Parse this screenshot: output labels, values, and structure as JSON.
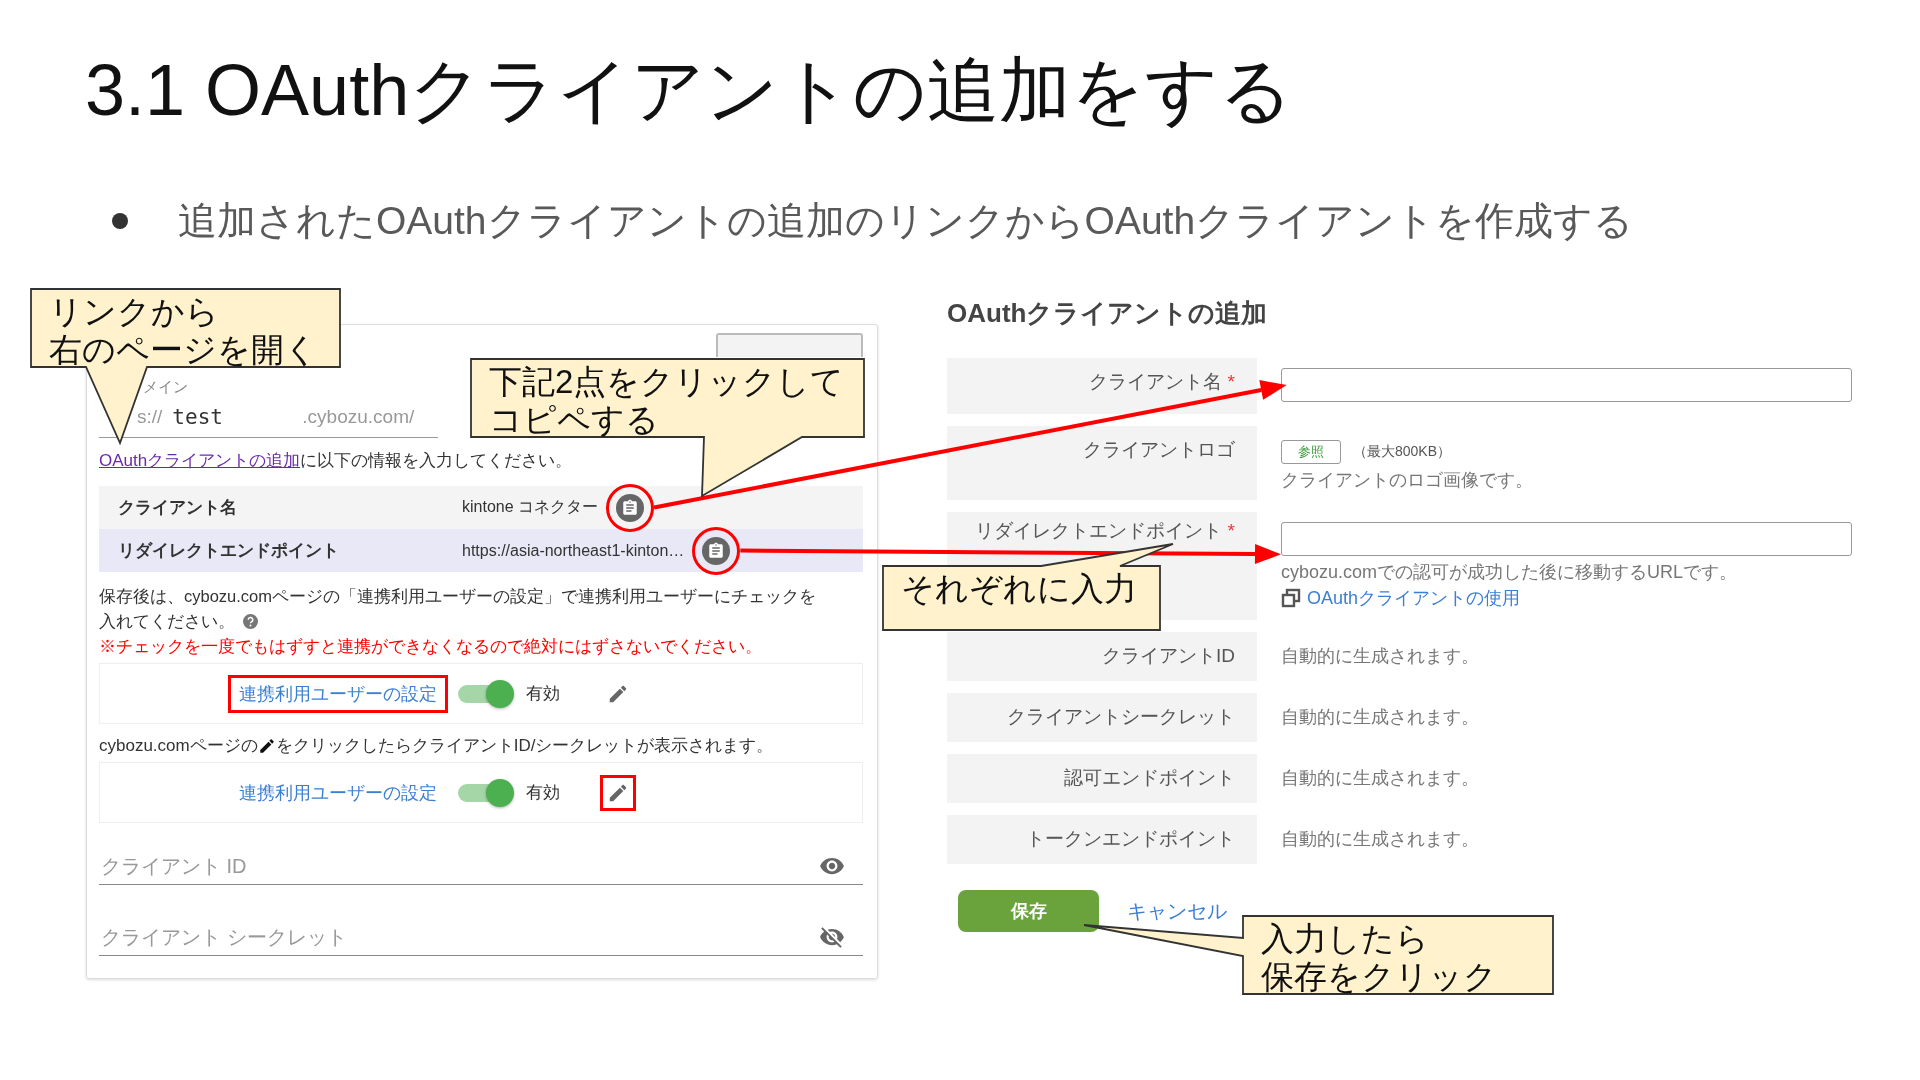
{
  "title": "3.1 OAuthクライアントの追加をする",
  "bullets": [
    "追加されたOAuthクライアントの追加のリンクからOAuthクライアントを作成する"
  ],
  "left_screen": {
    "domain_label": "メイン",
    "domain_prefix": "s://",
    "domain_value": "test",
    "domain_suffix": ".cybozu.com/",
    "instruction": {
      "link": "OAuthクライアントの追加",
      "text": "に以下の情報を入力してください。"
    },
    "info_rows": [
      {
        "label": "クライアント名",
        "value": "kintone コネクター",
        "highlighted": true
      },
      {
        "label": "リダイレクトエンドポイント",
        "value": "https://asia-northeast1-kinton…",
        "highlighted": true
      }
    ],
    "note_lines": [
      "保存後は、cybozu.comページの「連携利用ユーザーの設定」で連携利用ユーザーにチェックを",
      "入れてください。"
    ],
    "warning": "※チェックを一度でもはずすと連携ができなくなるので絶対にはずさないでください。",
    "settings_boxes": [
      {
        "link": "連携利用ユーザーの設定",
        "on": true,
        "state_label": "有効",
        "link_highlighted": true,
        "edit_highlighted": false
      },
      {
        "link": "連携利用ユーザーの設定",
        "on": true,
        "state_label": "有効",
        "link_highlighted": false,
        "edit_highlighted": true
      }
    ],
    "edit_hint": {
      "before": "cybozu.comページの",
      "after": "をクリックしたらクライアントID/シークレットが表示されます。"
    },
    "secret_fields": [
      {
        "placeholder": "クライアント ID",
        "visible": true
      },
      {
        "placeholder": "クライアント シークレット",
        "visible": false
      }
    ]
  },
  "right_screen": {
    "heading": "OAuthクライアントの追加",
    "rows": [
      {
        "kind": "input",
        "label": "クライアント名",
        "required_mark": "*"
      },
      {
        "kind": "file",
        "label": "クライアントロゴ",
        "button": "参照",
        "limit": "（最大800KB）",
        "help": "クライアントのロゴ画像です。"
      },
      {
        "kind": "input",
        "label": "リダイレクトエンドポイント",
        "required_mark": "*",
        "help": "cybozu.comでの認可が成功した後に移動するURLです。",
        "link": "OAuthクライアントの使用"
      },
      {
        "kind": "auto",
        "label": "クライアントID",
        "value": "自動的に生成されます。"
      },
      {
        "kind": "auto",
        "label": "クライアントシークレット",
        "value": "自動的に生成されます。"
      },
      {
        "kind": "auto",
        "label": "認可エンドポイント",
        "value": "自動的に生成されます。"
      },
      {
        "kind": "auto",
        "label": "トークンエンドポイント",
        "value": "自動的に生成されます。"
      }
    ],
    "save_button": "保存",
    "cancel_link": "キャンセル"
  },
  "callouts": [
    {
      "lines": [
        "リンクから",
        "右のページを開く"
      ]
    },
    {
      "lines": [
        "下記2点をクリックして",
        "コピペする"
      ]
    },
    {
      "lines": [
        "それぞれに入力"
      ]
    },
    {
      "lines": [
        "入力したら",
        "保存をクリック"
      ]
    }
  ]
}
